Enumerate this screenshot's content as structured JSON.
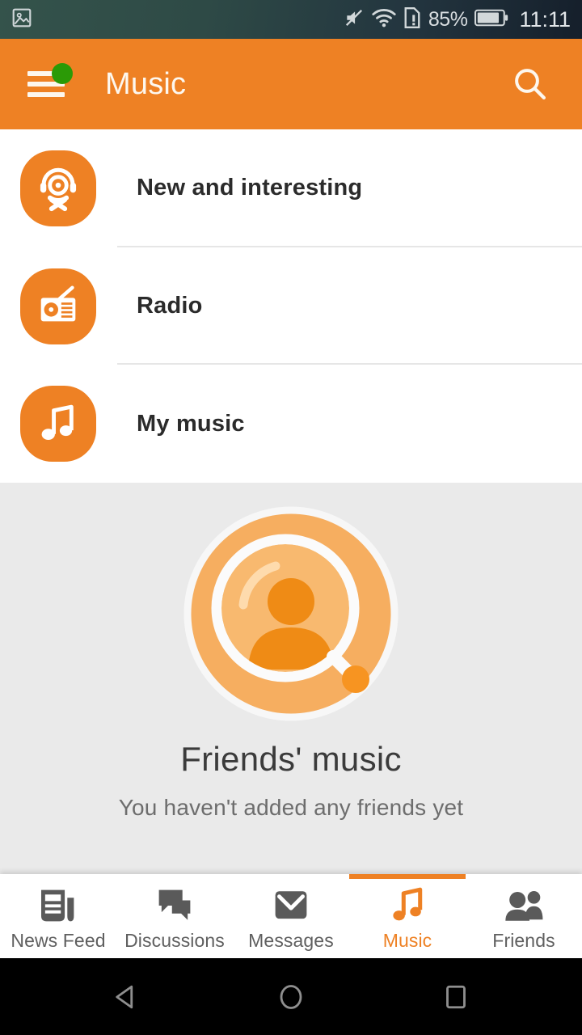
{
  "status_bar": {
    "left_icon": "screenshot-icon",
    "icons": [
      "mute-icon",
      "wifi-icon",
      "sim-alert-icon"
    ],
    "battery_percent": "85%",
    "battery_icon": "battery-icon",
    "clock": "11:11"
  },
  "app_bar": {
    "menu_icon": "hamburger-menu-icon",
    "has_notification_dot": true,
    "title": "Music",
    "search_icon": "search-icon",
    "background_color": "#ee8124"
  },
  "menu": {
    "items": [
      {
        "label": "New and interesting",
        "icon": "ok-headphones-icon"
      },
      {
        "label": "Radio",
        "icon": "radio-icon"
      },
      {
        "label": "My music",
        "icon": "music-note-icon"
      }
    ]
  },
  "friends_section": {
    "illustration": "magnifier-person-icon",
    "title": "Friends' music",
    "subtitle": "You haven't added any friends yet",
    "background_color": "#eaeaea"
  },
  "bottom_nav": {
    "active_index": 3,
    "accent_color": "#ee8124",
    "items": [
      {
        "label": "News Feed",
        "icon": "news-feed-icon"
      },
      {
        "label": "Discussions",
        "icon": "discussions-icon"
      },
      {
        "label": "Messages",
        "icon": "messages-icon"
      },
      {
        "label": "Music",
        "icon": "music-note-icon"
      },
      {
        "label": "Friends",
        "icon": "friends-icon"
      }
    ]
  },
  "android_nav": {
    "buttons": [
      {
        "name": "back-button",
        "icon": "triangle-back-icon"
      },
      {
        "name": "home-button",
        "icon": "circle-home-icon"
      },
      {
        "name": "recents-button",
        "icon": "square-recents-icon"
      }
    ]
  }
}
